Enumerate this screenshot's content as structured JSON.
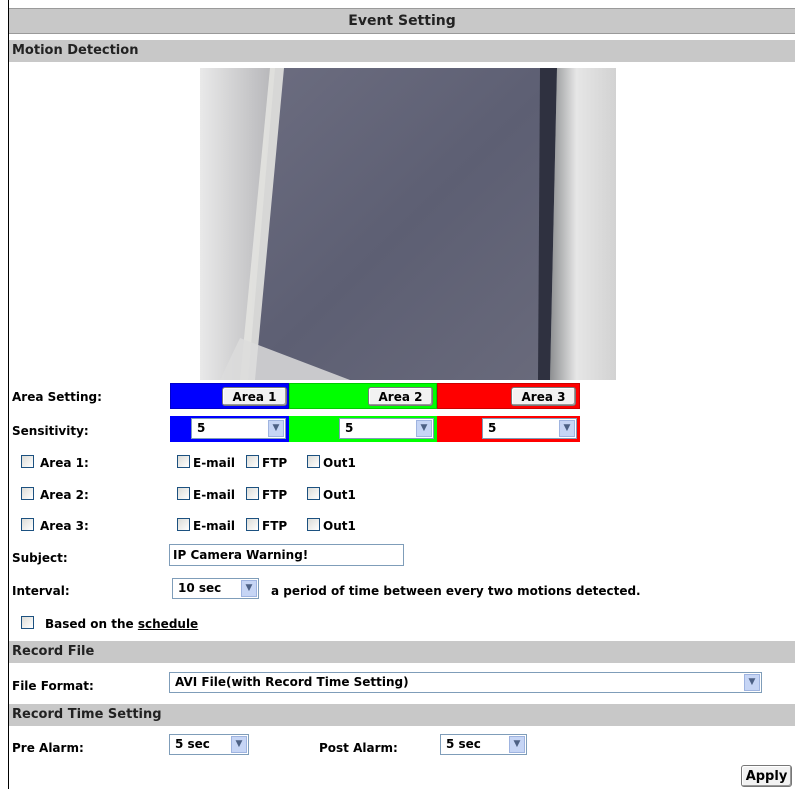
{
  "header": {
    "title": "Event Setting"
  },
  "motion_detection": {
    "section_title": "Motion Detection",
    "area_setting_label": "Area Setting:",
    "area_buttons": [
      "Area 1",
      "Area 2",
      "Area 3"
    ],
    "area_colors": [
      "#0000ff",
      "#00ff00",
      "#ff0000"
    ],
    "sensitivity_label": "Sensitivity:",
    "sensitivity_values": [
      "5",
      "5",
      "5"
    ],
    "area_rows": [
      {
        "label": "Area 1:",
        "email": "E-mail",
        "ftp": "FTP",
        "out": "Out1"
      },
      {
        "label": "Area 2:",
        "email": "E-mail",
        "ftp": "FTP",
        "out": "Out1"
      },
      {
        "label": "Area 3:",
        "email": "E-mail",
        "ftp": "FTP",
        "out": "Out1"
      }
    ],
    "subject_label": "Subject:",
    "subject_value": "IP Camera Warning!",
    "interval_label": "Interval:",
    "interval_value": "10 sec",
    "interval_desc": "a period of time between every two motions detected.",
    "schedule_prefix": "Based on the",
    "schedule_link": "schedule"
  },
  "record_file": {
    "section_title": "Record File",
    "file_format_label": "File Format:",
    "file_format_value": "AVI File(with Record Time Setting)"
  },
  "record_time": {
    "section_title": "Record Time Setting",
    "pre_alarm_label": "Pre Alarm:",
    "pre_alarm_value": "5 sec",
    "post_alarm_label": "Post Alarm:",
    "post_alarm_value": "5 sec"
  },
  "apply_label": "Apply"
}
